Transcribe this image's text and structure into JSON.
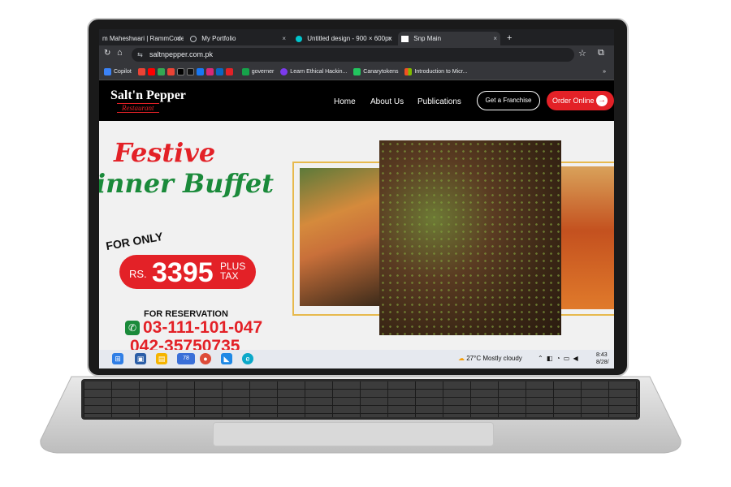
{
  "browser": {
    "tabs": [
      {
        "title": "m Maheshwari | RammCode",
        "close": "×"
      },
      {
        "title": "My Portfolio",
        "close": "×"
      },
      {
        "title": "Untitled design - 900 × 600px",
        "close": "×"
      },
      {
        "title": "Snp Main",
        "close": "×"
      }
    ],
    "new_tab": "+",
    "url": "saltnpepper.com.pk",
    "bookmarks": [
      "Copilot",
      "governer",
      "Learn Ethical Hackin...",
      "Canarytokens",
      "Introduction to Micr..."
    ],
    "bookmarks_more": "»"
  },
  "site": {
    "logo_main": "Salt'n Pepper",
    "logo_sub": "Restaurant",
    "nav": [
      "Home",
      "About Us",
      "Publications"
    ],
    "franchise_btn": "Get a Franchise",
    "order_btn": "Order Online",
    "order_arrow": "→"
  },
  "hero": {
    "line1": "Festive",
    "line2": "inner Buffet",
    "for_only": "FOR ONLY",
    "currency": "RS.",
    "price": "3395",
    "plus": "PLUS",
    "tax": "TAX",
    "reservation": "FOR RESERVATION",
    "phone1": "03-111-101-047",
    "phone2": "042-35750735"
  },
  "taskbar": {
    "badge": "78",
    "weather": "27°C  Mostly cloudy",
    "time": "8:43",
    "date": "8/28/"
  },
  "colors": {
    "brand_red": "#e32127",
    "brand_green": "#1a8a3a",
    "gold_frame": "#e7b94d"
  }
}
